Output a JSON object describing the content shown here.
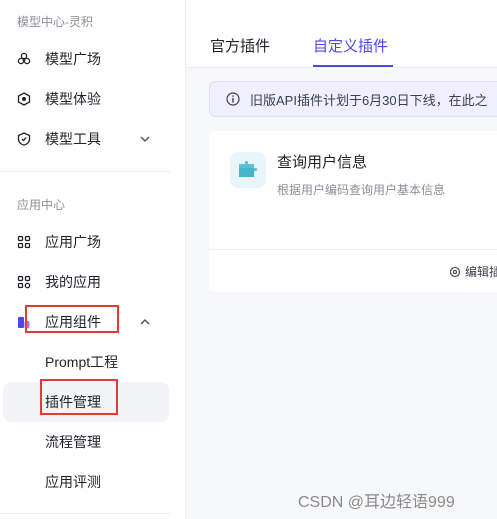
{
  "sidebar": {
    "section1_title": "模型中心-灵积",
    "section1_items": [
      {
        "label": "模型广场",
        "icon": "flower-icon"
      },
      {
        "label": "模型体验",
        "icon": "hexagon-icon"
      },
      {
        "label": "模型工具",
        "icon": "shield-gear-icon"
      }
    ],
    "section2_title": "应用中心",
    "section2_items": [
      {
        "label": "应用广场",
        "icon": "grid-icon"
      },
      {
        "label": "我的应用",
        "icon": "my-apps-icon"
      },
      {
        "label": "应用组件",
        "icon": "component-icon"
      }
    ],
    "sub_items": [
      {
        "label": "Prompt工程"
      },
      {
        "label": "插件管理"
      },
      {
        "label": "流程管理"
      },
      {
        "label": "应用评测"
      }
    ]
  },
  "tabs": [
    {
      "label": "官方插件"
    },
    {
      "label": "自定义插件"
    }
  ],
  "notice": {
    "text": "旧版API插件计划于6月30日下线，在此之"
  },
  "plugin_card": {
    "name": "查询用户信息",
    "description": "根据用户编码查询用户基本信息",
    "edit_label": "编辑插"
  },
  "watermark": "CSDN @耳边轻语999",
  "colors": {
    "accent": "#4e49e6",
    "highlight_box": "#e53935",
    "notice_bg": "#eef0fd"
  }
}
